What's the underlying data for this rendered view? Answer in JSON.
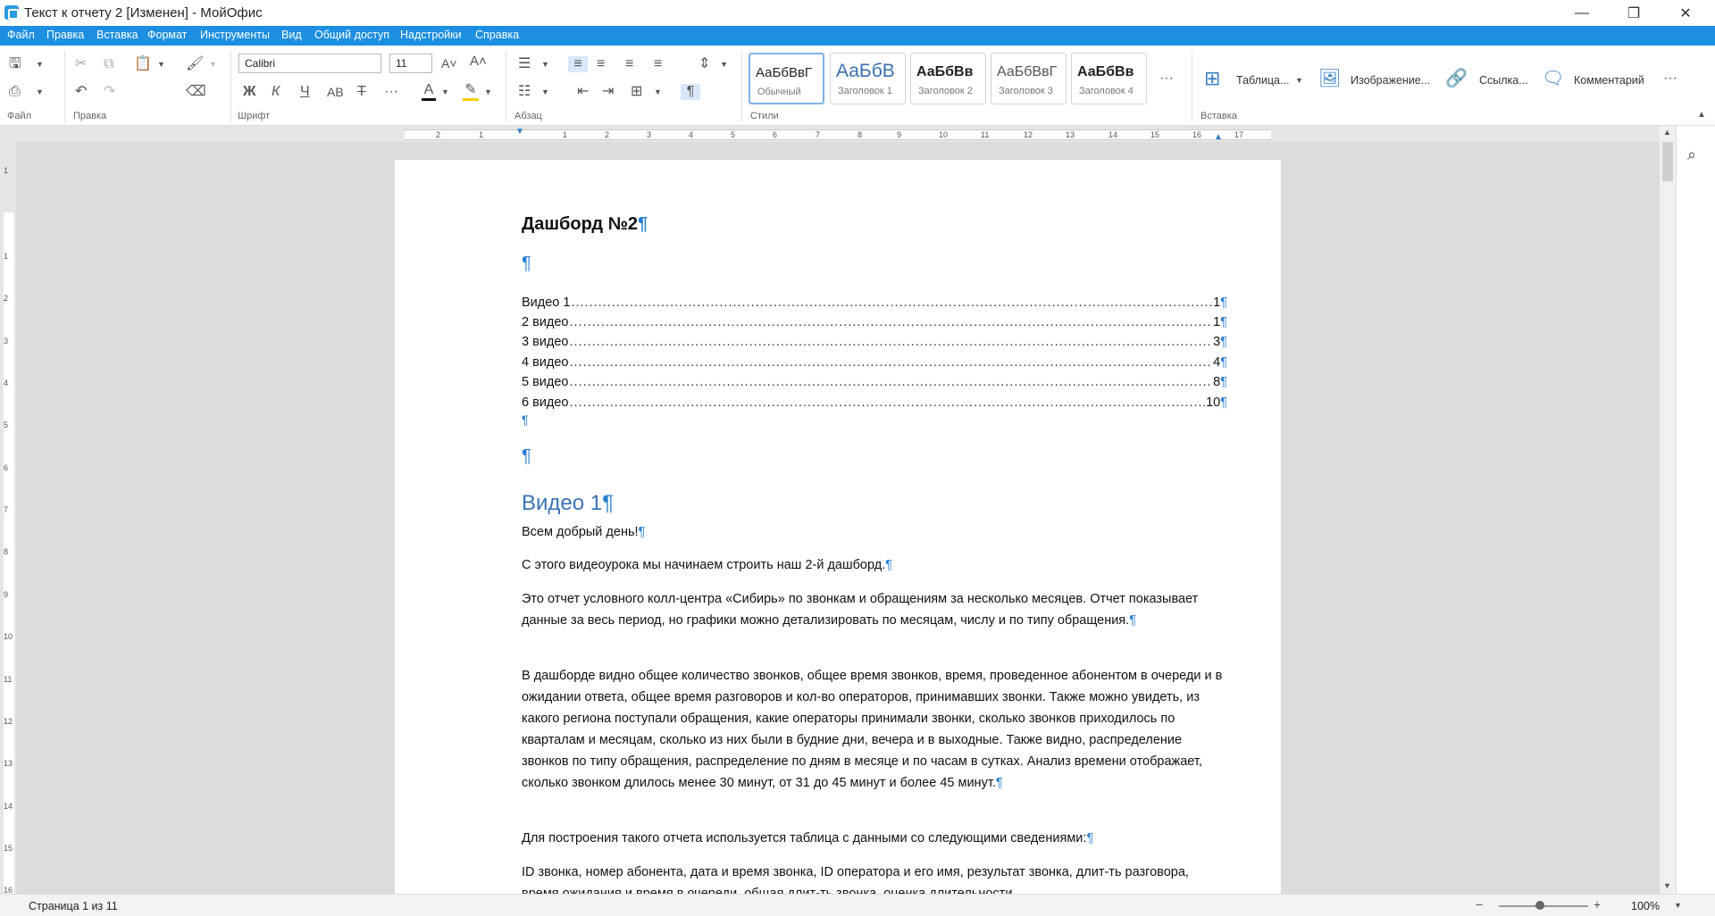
{
  "window": {
    "title": "Текст к отчету 2 [Изменен] - МойОфис",
    "minimize": "—",
    "restore": "❐",
    "close": "✕"
  },
  "menu": [
    "Файл",
    "Правка",
    "Вставка",
    "Формат",
    "Инструменты",
    "Вид",
    "Общий доступ",
    "Надстройки",
    "Справка"
  ],
  "ribbon": {
    "groups": {
      "file": "Файл",
      "edit": "Правка",
      "font": "Шрифт",
      "paragraph": "Абзац",
      "styles": "Стили",
      "insert": "Вставка"
    },
    "font_name": "Calibri",
    "font_size": "11",
    "font_buttons": {
      "bold": "Ж",
      "italic": "К",
      "underline": "Ч",
      "caps": "АВ",
      "strike": "Т",
      "more": "···",
      "color": "A"
    },
    "styles": [
      {
        "sample": "АаБбВвГ",
        "name": "Обычный"
      },
      {
        "sample": "АаБбВ",
        "name": "Заголовок 1"
      },
      {
        "sample": "АаБбВв",
        "name": "Заголовок 2"
      },
      {
        "sample": "АаБбВвГ",
        "name": "Заголовок 3"
      },
      {
        "sample": "АаБбВв",
        "name": "Заголовок 4"
      }
    ],
    "styles_more": "···",
    "insert": {
      "table": "Таблица...",
      "image": "Изображение...",
      "link": "Ссылка...",
      "comment": "Комментарий",
      "more": "···"
    }
  },
  "ruler": {
    "h_numbers": [
      "2",
      "1",
      "1",
      "2",
      "3",
      "4",
      "5",
      "6",
      "7",
      "8",
      "9",
      "10",
      "11",
      "12",
      "13",
      "14",
      "15",
      "16",
      "17"
    ],
    "v_numbers": [
      "1",
      "1",
      "2",
      "3",
      "4",
      "5",
      "6",
      "7",
      "8",
      "9",
      "10",
      "11",
      "12",
      "13",
      "14",
      "15",
      "16"
    ]
  },
  "document": {
    "title": "Дашборд №2",
    "pilcrow": "¶",
    "toc": [
      {
        "label": "Видео 1",
        "page": "1"
      },
      {
        "label": "2 видео",
        "page": "1"
      },
      {
        "label": "3 видео",
        "page": "3"
      },
      {
        "label": "4 видео",
        "page": "4"
      },
      {
        "label": "5 видео",
        "page": "8"
      },
      {
        "label": "6 видео",
        "page": "10"
      }
    ],
    "heading1": "Видео 1",
    "p1": "Всем добрый день!",
    "p2": "С этого видеоурока мы начинаем строить наш 2-й дашборд.",
    "p3": "Это отчет условного колл-центра «Сибирь» по звонкам и обращениям за несколько месяцев. Отчет показывает данные за весь период, но графики можно детализировать по месяцам, числу и по типу обращения.",
    "p4": "В дашборде видно общее количество звонков, общее время звонков, время, проведенное абонентом в очереди и в ожидании ответа, общее время разговоров и кол-во операторов, принимавших звонки. Также можно увидеть, из какого региона поступали обращения, какие операторы принимали звонки, сколько звонков приходилось по кварталам и месяцам, сколько из них были в будние дни, вечера и в выходные. Также видно, распределение звонков по типу обращения, распределение по дням в месяце и по часам в сутках. Анализ времени отображает, сколько звонком длилось менее 30 минут, от 31 до 45 минут и более 45 минут.",
    "p5": "Для построения такого отчета используется таблица с данными со следующими сведениями:",
    "p6": "ID звонка, номер абонента, дата и время звонка, ID оператора и его имя, результат звонка, длит-ть разговора, время ожидания и время в очереди, общая длит-ть звонка, оценка длительности"
  },
  "status": {
    "page_info": "Страница 1 из 11",
    "zoom": "100%",
    "zoom_minus": "−",
    "zoom_plus": "+"
  }
}
